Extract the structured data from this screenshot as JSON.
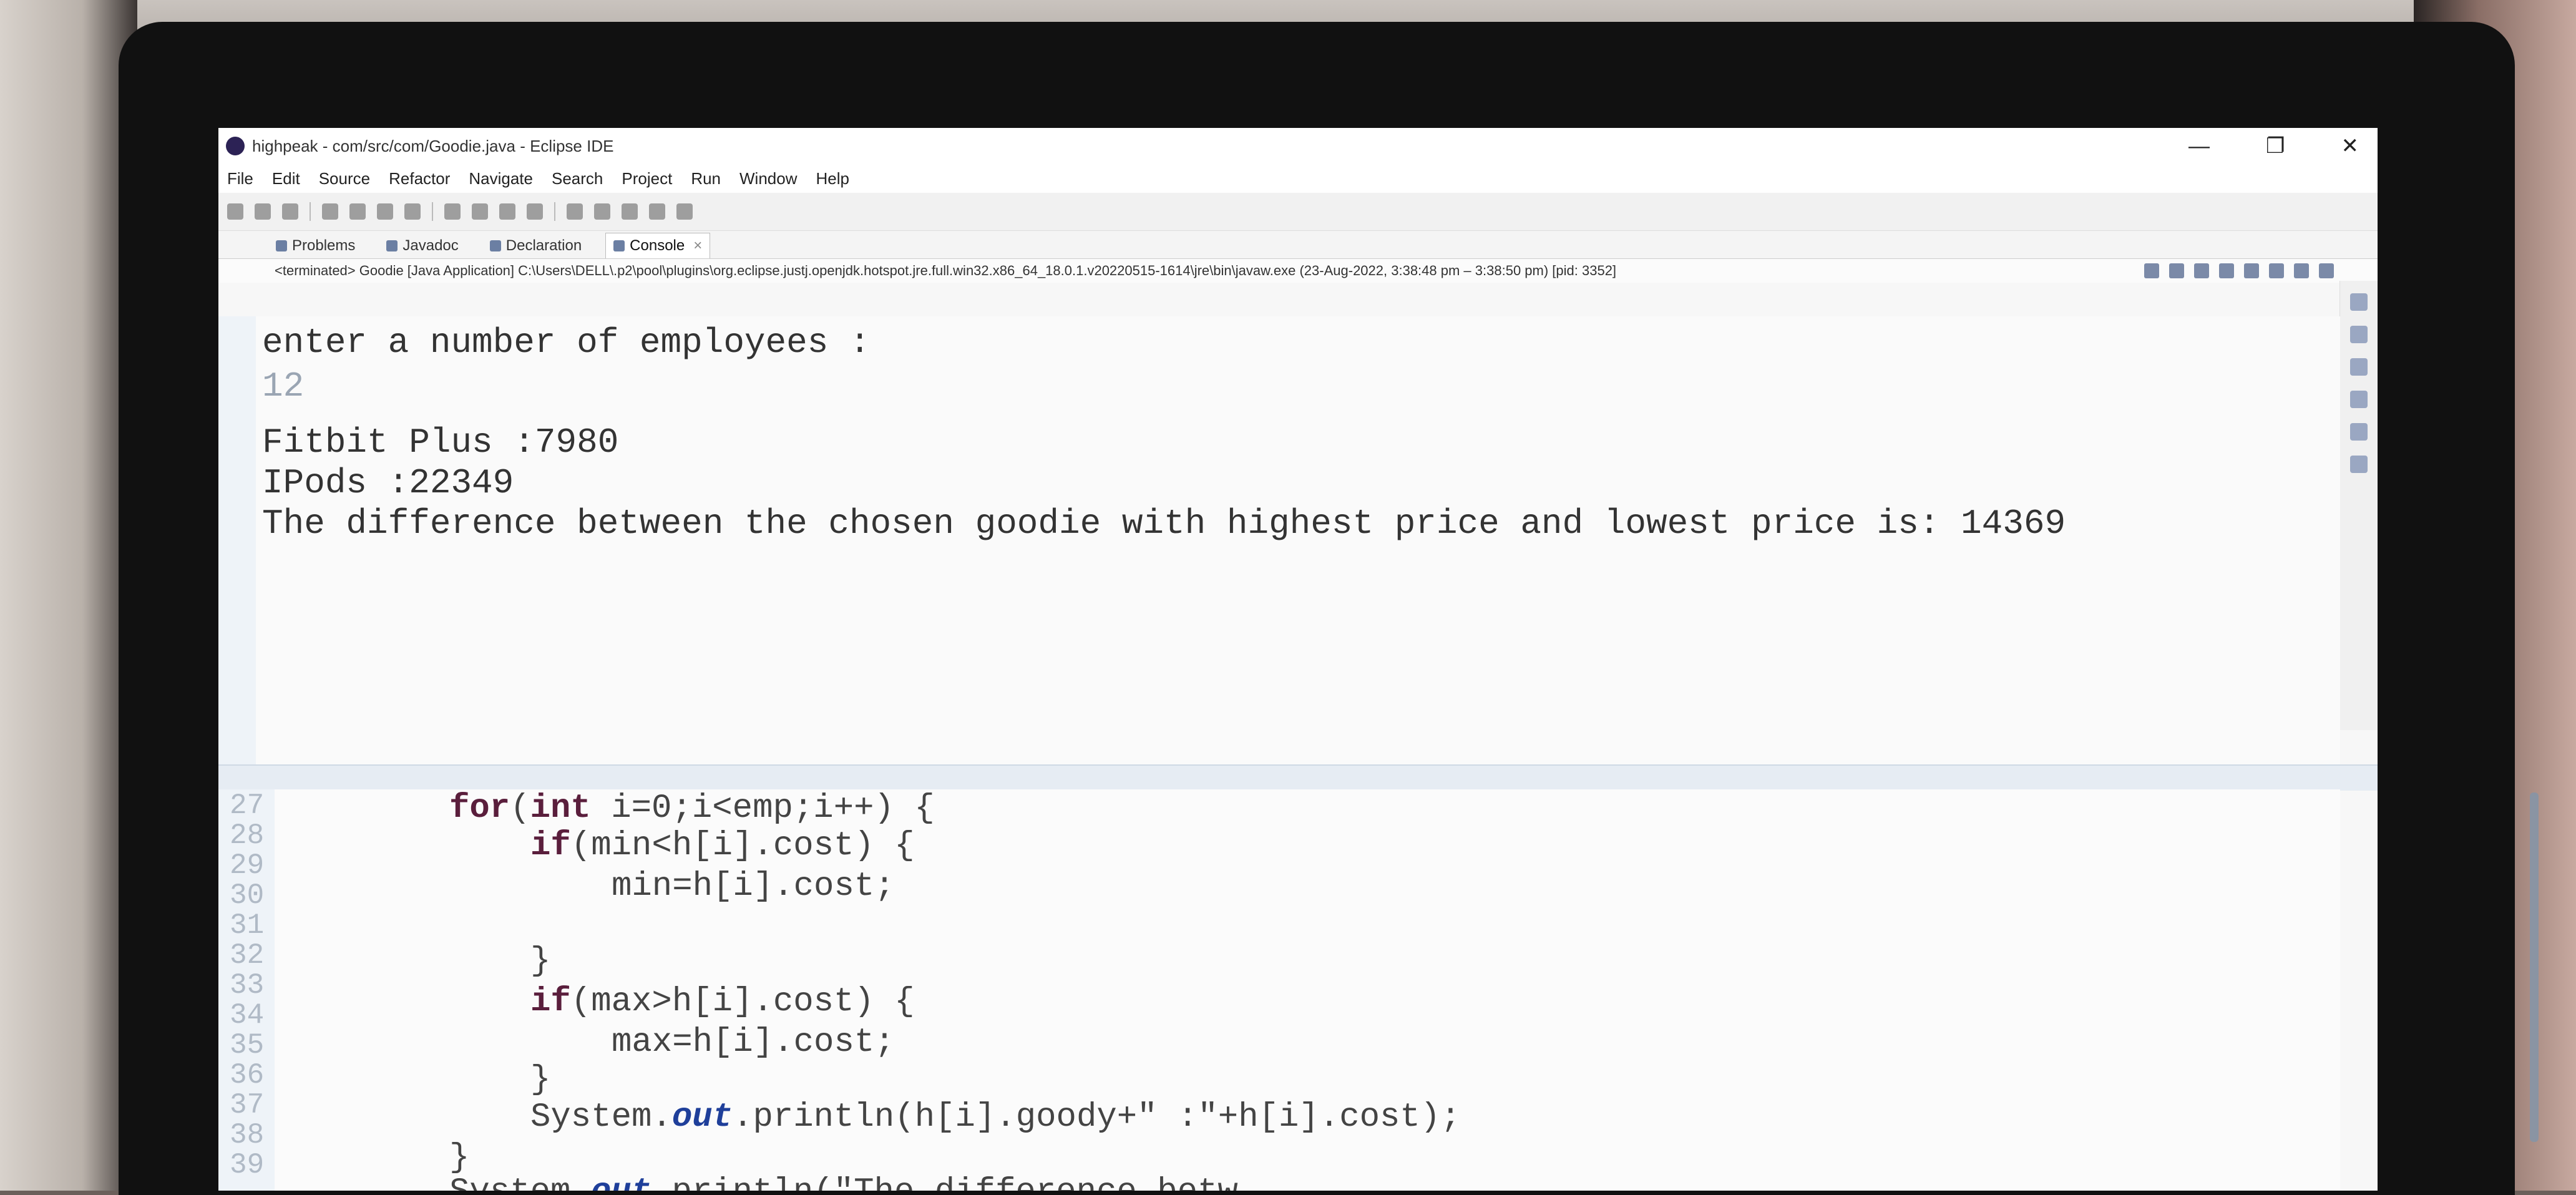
{
  "window": {
    "title": "highpeak - com/src/com/Goodie.java - Eclipse IDE",
    "controls": {
      "minimize": "—",
      "maximize": "❐",
      "close": "✕"
    }
  },
  "menu": [
    "File",
    "Edit",
    "Source",
    "Refactor",
    "Navigate",
    "Search",
    "Project",
    "Run",
    "Window",
    "Help"
  ],
  "tabs": {
    "problems": "Problems",
    "javadoc": "Javadoc",
    "declaration": "Declaration",
    "console": "Console"
  },
  "console": {
    "status": "<terminated> Goodie [Java Application] C:\\Users\\DELL\\.p2\\pool\\plugins\\org.eclipse.justj.openjdk.hotspot.jre.full.win32.x86_64_18.0.1.v20220515-1614\\jre\\bin\\javaw.exe  (23-Aug-2022, 3:38:48 pm – 3:38:50 pm) [pid: 3352]",
    "lines": [
      "enter a number of employees :",
      "12",
      "Fitbit Plus :7980",
      "IPods :22349",
      "The difference between the chosen goodie with highest price and lowest price is: 14369"
    ]
  },
  "editor": {
    "line_numbers": [
      "27",
      "28",
      "29",
      "30",
      "31",
      "32",
      "33",
      "34",
      "35",
      "36",
      "37",
      "38",
      "39"
    ],
    "code": {
      "l27_kw": "for",
      "l27_kw2": "int",
      "l27_a": "(",
      "l27_b": " i=0;i<emp;i++) {",
      "l28_kw": "if",
      "l28_rest": "(min<h[i].cost) {",
      "l29": "min=h[i].cost;",
      "l31": "}",
      "l32_kw": "if",
      "l32_rest": "(max>h[i].cost) {",
      "l33": "max=h[i].cost;",
      "l34": "}",
      "l35_a": "System.",
      "l35_fld": "out",
      "l35_b": ".println(h[i].goody+\" :\"+h[i].cost);",
      "l37": "}",
      "l38_a": "System.",
      "l38_fld": "out",
      "l38_b": ".println(\"The difference betw"
    }
  }
}
